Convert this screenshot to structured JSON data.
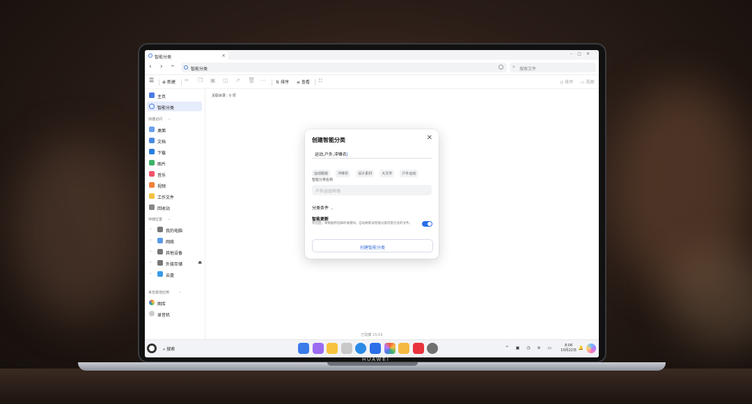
{
  "device": {
    "brand": "HUAWEI"
  },
  "window": {
    "tab_title": "智能分类",
    "tab_icon": "smart-category-icon",
    "nav": {
      "back": "‹",
      "forward": "›",
      "up": "^"
    },
    "address": "智能分类",
    "search_placeholder": "搜索文件"
  },
  "toolbar": {
    "new_label": "新建",
    "sort_label": "排序",
    "view_label": "查看",
    "right_1": "排序",
    "right_2": "视图"
  },
  "sidebar": {
    "top_items": [
      {
        "label": "主页",
        "icon": "home-icon",
        "color": "#4a7de2"
      },
      {
        "label": "智能分类",
        "icon": "smart-category-icon",
        "color": "#4a7de2"
      }
    ],
    "quick_access_title": "快捷访问",
    "quick_access": [
      {
        "label": "桌面",
        "icon": "desktop-icon",
        "color": "#6aa0e8"
      },
      {
        "label": "文档",
        "icon": "document-icon",
        "color": "#4a8be0"
      },
      {
        "label": "下载",
        "icon": "download-icon",
        "color": "#2a7de0"
      },
      {
        "label": "图片",
        "icon": "picture-icon",
        "color": "#3db36b"
      },
      {
        "label": "音乐",
        "icon": "music-icon",
        "color": "#f0546a"
      },
      {
        "label": "视频",
        "icon": "video-icon",
        "color": "#f0803c"
      },
      {
        "label": "工作文件",
        "icon": "folder-icon",
        "color": "#f5c242"
      },
      {
        "label": "回收站",
        "icon": "trash-icon",
        "color": "#888888"
      }
    ],
    "storage_title": "存储位置",
    "storage": [
      {
        "label": "我的电脑",
        "icon": "computer-icon",
        "color": "#777777"
      },
      {
        "label": "网络",
        "icon": "network-icon",
        "color": "#5a9ae6"
      },
      {
        "label": "其他设备",
        "icon": "device-icon",
        "color": "#777777"
      },
      {
        "label": "外接存储",
        "icon": "external-drive-icon",
        "color": "#777777"
      },
      {
        "label": "云盘",
        "icon": "cloud-icon",
        "color": "#3a9ae6"
      }
    ],
    "apps_title": "来自其他应用",
    "apps": [
      {
        "label": "图库",
        "icon": "gallery-icon",
        "color": "#f28c38"
      },
      {
        "label": "录音机",
        "icon": "recorder-icon",
        "color": "#999999"
      }
    ]
  },
  "content": {
    "related": "关联目录：0 项",
    "status": "已隐藏 15/16"
  },
  "dialog": {
    "title": "创建智能分类",
    "input_value": "运动,户外,冲锋衣",
    "tags": [
      "运动服装",
      "冲锋衣",
      "设计素材",
      "大文件",
      "户外运动"
    ],
    "name_label": "智能分类名称",
    "name_placeholder": "户外运动市场",
    "conditions_label": "分类条件",
    "update_label": "智能更新",
    "update_desc": "开启后，将根据所选择的关键词，自动刷新该智能分类内容包含的文件。",
    "update_on": true,
    "create_button": "创建智能分类"
  },
  "taskbar": {
    "search_label": "搜索",
    "apps": [
      {
        "name": "app-launcher",
        "color": "#3a7be8"
      },
      {
        "name": "gallery",
        "color": "#9b6bf0"
      },
      {
        "name": "notes",
        "color": "#f7c23c"
      },
      {
        "name": "recycle",
        "color": "#c8c8c8"
      },
      {
        "name": "browser",
        "color": "#2a8ae6"
      },
      {
        "name": "mail",
        "color": "#2a6ee8"
      },
      {
        "name": "photos",
        "color": "#f0603c"
      },
      {
        "name": "memo",
        "color": "#f5b942"
      },
      {
        "name": "store",
        "color": "#e8323c"
      },
      {
        "name": "settings",
        "color": "#707070"
      }
    ],
    "time": "8:06",
    "date": "10月22日"
  }
}
